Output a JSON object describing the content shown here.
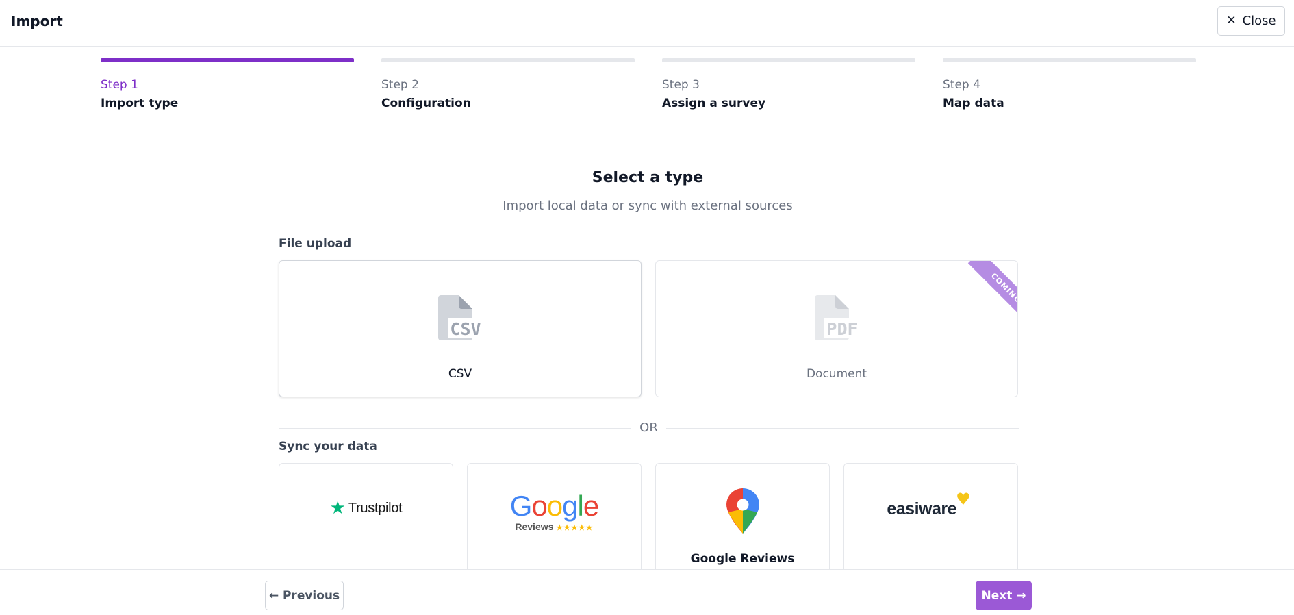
{
  "header": {
    "title": "Import",
    "close_label": "Close",
    "close_icon": "x-icon"
  },
  "steps": [
    {
      "number": "Step 1",
      "name": "Import type",
      "active": true
    },
    {
      "number": "Step 2",
      "name": "Configuration",
      "active": false
    },
    {
      "number": "Step 3",
      "name": "Assign a survey",
      "active": false
    },
    {
      "number": "Step 4",
      "name": "Map data",
      "active": false
    }
  ],
  "main": {
    "title": "Select a type",
    "subtitle": "Import local data or sync with external sources"
  },
  "file_upload": {
    "label": "File upload",
    "options": [
      {
        "label": "CSV",
        "icon": "csv-file-icon",
        "icon_text": "CSV",
        "selected": true
      },
      {
        "label": "Document",
        "icon": "pdf-file-icon",
        "icon_text": "PDF",
        "badge": "COMING"
      }
    ]
  },
  "divider_text": "OR",
  "sync": {
    "label": "Sync your data",
    "options": [
      {
        "logo": "trustpilot-logo",
        "logo_text": "Trustpilot"
      },
      {
        "logo": "google-reviews-logo",
        "logo_text": "Google",
        "logo_subtext": "Reviews"
      },
      {
        "logo": "google-maps-pin-icon",
        "label": "Google Reviews"
      },
      {
        "logo": "easiware-logo",
        "logo_text": "easiware"
      }
    ]
  },
  "footer": {
    "previous_label": "← Previous",
    "next_label": "Next →"
  },
  "colors": {
    "accent": "#7e2fc8",
    "next_button": "#9b59d6",
    "badge": "#b58ce3",
    "trustpilot": "#00b67a"
  }
}
